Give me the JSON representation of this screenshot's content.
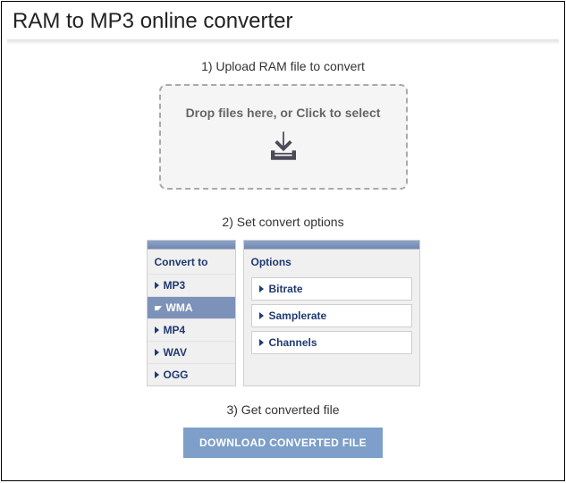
{
  "title": "RAM to MP3 online converter",
  "step1": {
    "label": "1) Upload RAM file to convert",
    "dropText": "Drop files here, or Click to select"
  },
  "step2": {
    "label": "2) Set convert options",
    "convertTitle": "Convert to",
    "formats": [
      "MP3",
      "WMA",
      "MP4",
      "WAV",
      "OGG"
    ],
    "activeFormat": "WMA",
    "optionsTitle": "Options",
    "options": [
      "Bitrate",
      "Samplerate",
      "Channels"
    ]
  },
  "step3": {
    "label": "3) Get converted file",
    "button": "DOWNLOAD CONVERTED FILE"
  }
}
